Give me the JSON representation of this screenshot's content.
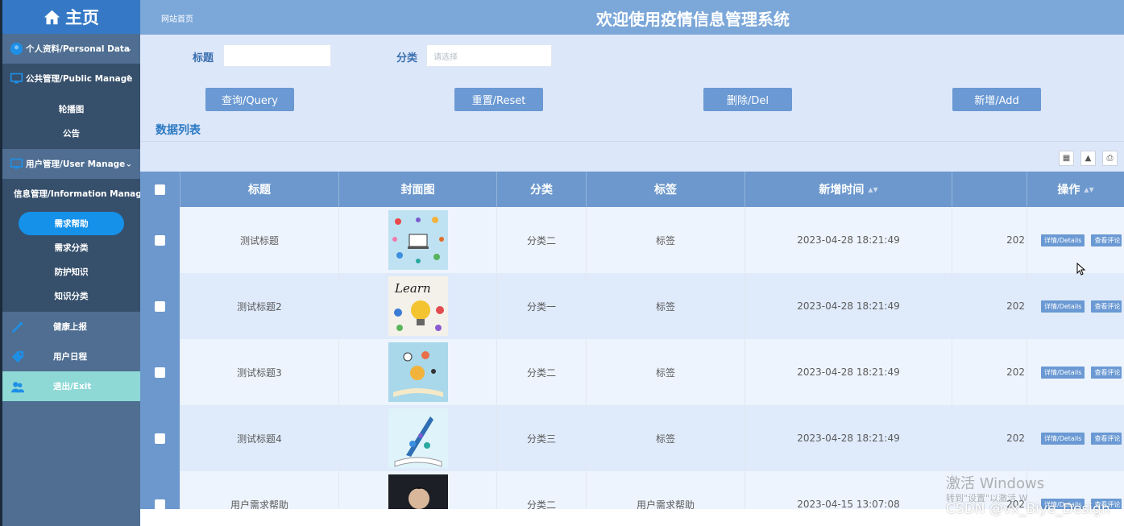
{
  "sidebar": {
    "home_label": "主页",
    "groups": [
      {
        "label": "个人资料/Personal Data"
      },
      {
        "label": "公共管理/Public Manage",
        "items": [
          "轮播图",
          "公告"
        ]
      },
      {
        "label": "用户管理/User Manage"
      },
      {
        "label": "信息管理/Information Manage",
        "items": [
          "需求帮助",
          "需求分类",
          "防护知识",
          "知识分类"
        ]
      }
    ],
    "solo": [
      "健康上报",
      "用户日程"
    ],
    "exit_label": "退出/Exit"
  },
  "header": {
    "breadcrumb": "网站首页",
    "title": "欢迎使用疫情信息管理系统"
  },
  "filters": {
    "title_label": "标题",
    "title_value": "",
    "category_label": "分类",
    "category_placeholder": "请选择"
  },
  "buttons": {
    "query": "查询/Query",
    "reset": "重置/Reset",
    "delete": "删除/Del",
    "add": "新增/Add"
  },
  "list_title": "数据列表",
  "table": {
    "columns": [
      "标题",
      "封面图",
      "分类",
      "标签",
      "新增时间",
      "",
      "操作"
    ],
    "rows": [
      {
        "title": "测试标题",
        "category": "分类二",
        "tag": "标签",
        "time": "2023-04-28 18:21:49",
        "extra": "202"
      },
      {
        "title": "测试标题2",
        "category": "分类一",
        "tag": "标签",
        "time": "2023-04-28 18:21:49",
        "extra": "202"
      },
      {
        "title": "测试标题3",
        "category": "分类二",
        "tag": "标签",
        "time": "2023-04-28 18:21:49",
        "extra": "202"
      },
      {
        "title": "测试标题4",
        "category": "分类三",
        "tag": "标签",
        "time": "2023-04-28 18:21:49",
        "extra": "202"
      },
      {
        "title": "用户需求帮助",
        "category": "分类二",
        "tag": "用户需求帮助",
        "time": "2023-04-15 13:07:08",
        "extra": "202"
      }
    ],
    "details_label": "详情/Details",
    "comment_label": "查看评论"
  },
  "watermark": {
    "line1": "激活 Windows",
    "line2": "转到\"设置\"以激活 W",
    "csdn": "CSDN @vx_Biye_Design"
  },
  "colors": {
    "sidebar": "#4f6e91",
    "home": "#3579c6",
    "header": "#7ba7d9",
    "main_bg": "#dde7fa",
    "button": "#6a99d3",
    "active_item": "#1591ea",
    "exit_bg": "#8ed8d6"
  }
}
